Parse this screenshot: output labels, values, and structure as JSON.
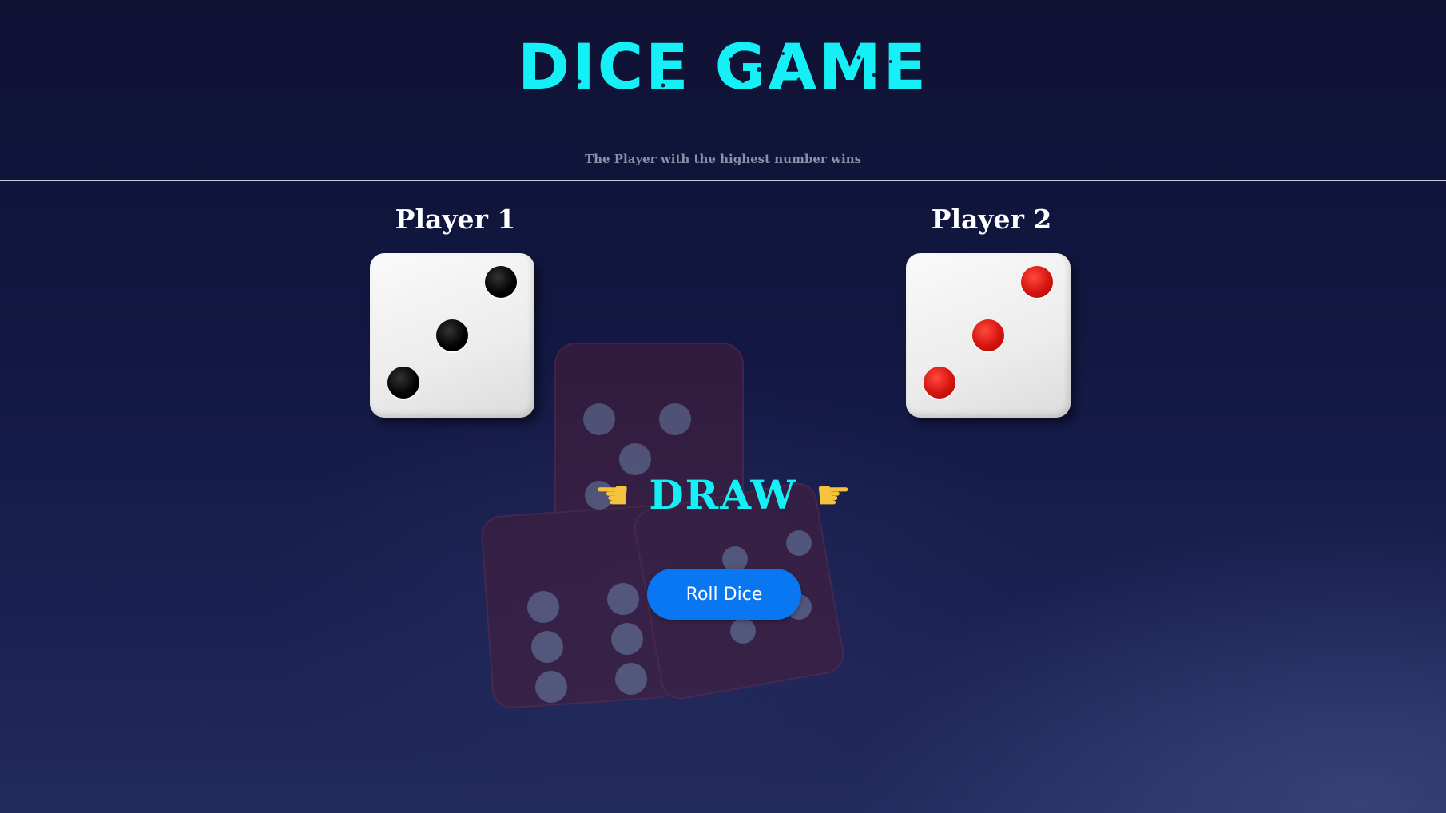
{
  "header": {
    "title": "DICE GAME",
    "subtitle": "The Player with the highest number wins"
  },
  "players": [
    {
      "name": "Player 1",
      "die_value": 3,
      "pip_color": "#000000"
    },
    {
      "name": "Player 2",
      "die_value": 3,
      "pip_color": "#d4140f"
    }
  ],
  "result": {
    "text": "DRAW",
    "left_icon": "pointing-right-hand-icon",
    "right_icon": "pointing-right-hand-icon"
  },
  "controls": {
    "roll_label": "Roll Dice"
  },
  "colors": {
    "accent": "#14f0f6",
    "button": "#0a77f2",
    "background": "#121741"
  }
}
